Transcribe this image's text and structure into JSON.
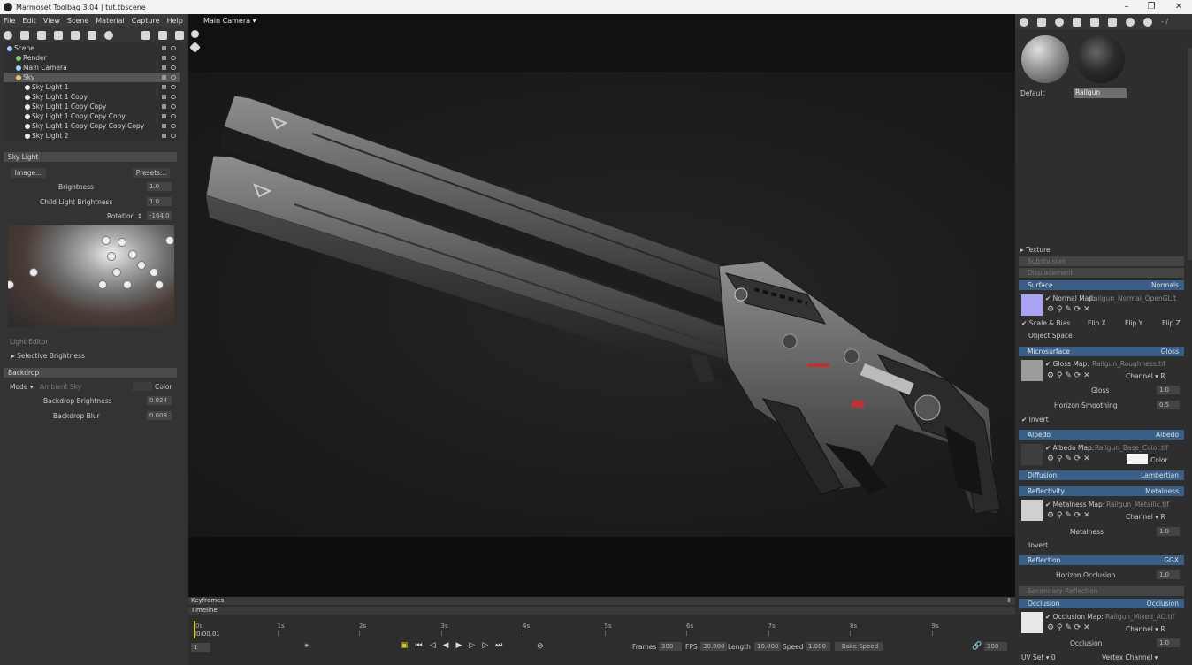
{
  "window": {
    "title": "Marmoset Toolbag 3.04  |  tut.tbscene"
  },
  "menu": [
    "File",
    "Edit",
    "View",
    "Scene",
    "Material",
    "Capture",
    "Help"
  ],
  "viewport": {
    "camera_label": "Main Camera ▾"
  },
  "scene_tree": [
    {
      "label": "Scene",
      "indent": 0
    },
    {
      "label": "Render",
      "indent": 1
    },
    {
      "label": "Main Camera",
      "indent": 1
    },
    {
      "label": "Sky",
      "indent": 1,
      "selected": true
    },
    {
      "label": "Sky Light 1",
      "indent": 2
    },
    {
      "label": "Sky Light 1 Copy",
      "indent": 2
    },
    {
      "label": "Sky Light 1 Copy Copy",
      "indent": 2
    },
    {
      "label": "Sky Light 1 Copy Copy Copy",
      "indent": 2
    },
    {
      "label": "Sky Light 1 Copy Copy Copy Copy",
      "indent": 2
    },
    {
      "label": "Sky Light 2",
      "indent": 2
    }
  ],
  "skylight": {
    "header": "Sky Light",
    "image_btn": "Image...",
    "presets_btn": "Presets...",
    "brightness_label": "Brightness",
    "brightness": "1.0",
    "child_label": "Child Light Brightness",
    "child": "1.0",
    "rotation_label": "Rotation ↕",
    "rotation": "-164.0",
    "light_editor": "Light Editor",
    "selective": "▸ Selective Brightness"
  },
  "backdrop": {
    "header": "Backdrop",
    "mode_label": "Mode ▾",
    "mode_value": "Ambient Sky",
    "color_label": "Color",
    "bright_label": "Backdrop Brightness",
    "bright": "0.024",
    "blur_label": "Backdrop Blur",
    "blur": "0.008"
  },
  "timeline": {
    "keyframes": "Keyframes",
    "timeline": "Timeline",
    "ticks": [
      "0s",
      "1s",
      "2s",
      "3s",
      "4s",
      "5s",
      "6s",
      "7s",
      "8s",
      "9s"
    ],
    "time": "0:00.01",
    "frame": "1",
    "frames_label": "Frames",
    "frames": "300",
    "fps_label": "FPS",
    "fps": "30.000",
    "length_label": "Length",
    "length": "10.000",
    "speed_label": "Speed",
    "speed": "1.000",
    "bake": "Bake Speed",
    "end": "300"
  },
  "materials": {
    "default": "Default",
    "railgun": "Railgun",
    "zoom": "- / "
  },
  "props": {
    "texture": "▸ Texture",
    "subdivision": "Subdivision",
    "displacement": "Displacement",
    "surface": "Surface",
    "surface_v": "Normals",
    "normal_map": "✔ Normal Map:",
    "normal_file": "Railgun_Normal_OpenGL.t",
    "scale_bias": "✔ Scale & Bias",
    "flipx": "Flip X",
    "flipy": "Flip Y",
    "flipz": "Flip Z",
    "object_space": "Object Space",
    "microsurface": "Microsurface",
    "micro_v": "Gloss",
    "gloss_map": "✔ Gloss Map:",
    "gloss_file": "Railgun_Roughness.tif",
    "channel": "Channel ▾ R",
    "gloss": "Gloss",
    "gloss_v": "1.0",
    "horizon_smooth": "Horizon Smoothing",
    "hs_v": "0.5",
    "invert": "✔ Invert",
    "albedo": "Albedo",
    "albedo_v": "Albedo",
    "albedo_map": "✔ Albedo Map:",
    "albedo_file": "Railgun_Base_Color.tif",
    "color": "Color",
    "diffusion": "Diffusion",
    "diffusion_v": "Lambertian",
    "reflectivity": "Reflectivity",
    "refl_v": "Metalness",
    "metal_map": "✔ Metalness Map:",
    "metal_file": "Railgun_Metallic.tif",
    "metalness": "Metalness",
    "metal_val": "1.0",
    "invert2": "Invert",
    "reflection": "Reflection",
    "reflection_v": "GGX",
    "horizon_occ": "Horizon Occlusion",
    "ho_v": "1.0",
    "secondary": "Secondary Reflection",
    "occlusion": "Occlusion",
    "occl_v": "Occlusion",
    "occ_map": "✔ Occlusion Map:",
    "occ_file": "Railgun_Mixed_AO.tif",
    "occlusion_l": "Occlusion",
    "occ_val": "1.0",
    "uvset": "UV Set ▾ 0",
    "vertex": "Vertex Channel ▾"
  },
  "colors": {
    "accent": "#3a5f87",
    "normal_swatch": "#a9a3f5"
  }
}
